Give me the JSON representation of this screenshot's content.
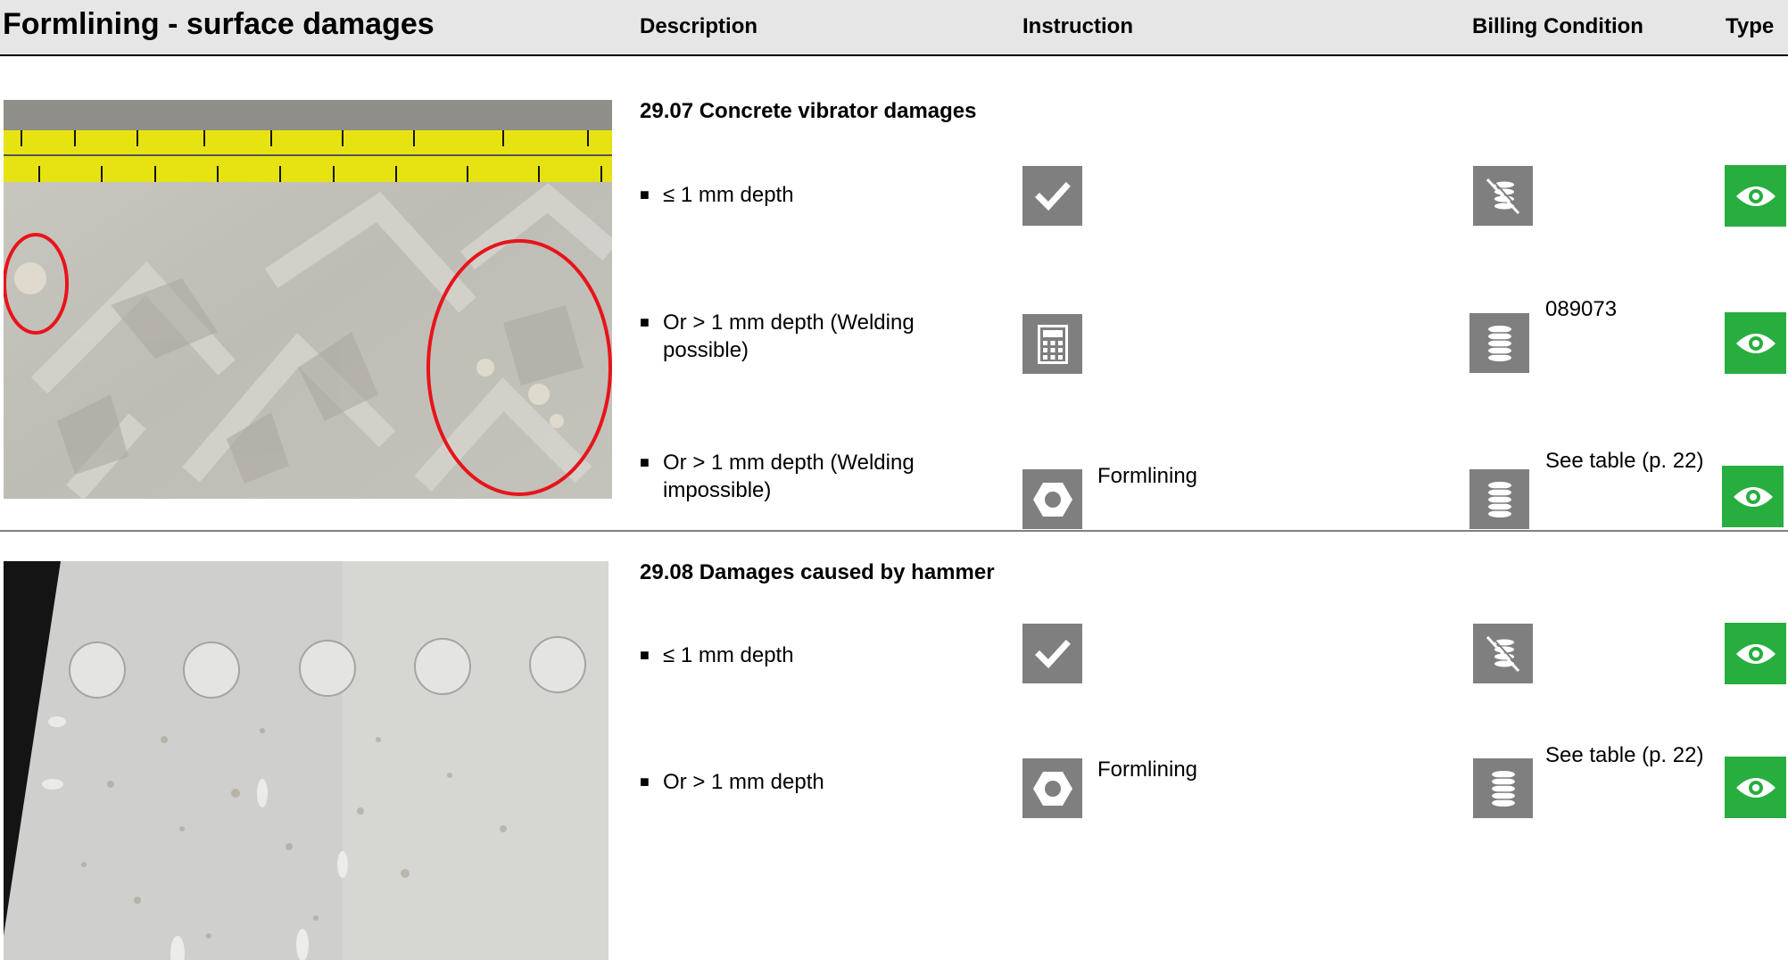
{
  "header": {
    "title": "Formlining - surface damages",
    "col_description": "Description",
    "col_instruction": "Instruction",
    "col_billing": "Billing Condition",
    "col_type": "Type"
  },
  "sections": [
    {
      "title": "29.07 Concrete vibrator damages",
      "items": [
        {
          "text": "≤ 1 mm depth",
          "instruction_icon": "checkmark-icon",
          "instruction_text": "",
          "billing_icon": "no-cost-icon",
          "billing_text": "",
          "type_icon": "eye-icon"
        },
        {
          "text": "Or  > 1 mm depth (Welding possible)",
          "instruction_icon": "calculator-icon",
          "instruction_text": "",
          "billing_icon": "coin-stack-icon",
          "billing_text": "089073",
          "type_icon": "eye-icon"
        },
        {
          "text": "Or > 1 mm depth (Welding impossible)",
          "instruction_icon": "hex-nut-icon",
          "instruction_text": "Formlining",
          "billing_icon": "coin-stack-icon",
          "billing_text": "See table (p. 22)",
          "type_icon": "eye-icon"
        }
      ]
    },
    {
      "title": "29.08 Damages caused by hammer",
      "items": [
        {
          "text": "≤ 1 mm depth",
          "instruction_icon": "checkmark-icon",
          "instruction_text": "",
          "billing_icon": "no-cost-icon",
          "billing_text": "",
          "type_icon": "eye-icon"
        },
        {
          "text": "Or > 1 mm depth",
          "instruction_icon": "hex-nut-icon",
          "instruction_text": "Formlining",
          "billing_icon": "coin-stack-icon",
          "billing_text": "See table (p. 22)",
          "type_icon": "eye-icon"
        }
      ]
    }
  ],
  "bullet_glyph": "■",
  "colors": {
    "header_bg": "#e6e6e6",
    "icon_gray": "#7f7f7f",
    "type_green": "#27ae3f",
    "marker_red": "#e8141b"
  }
}
